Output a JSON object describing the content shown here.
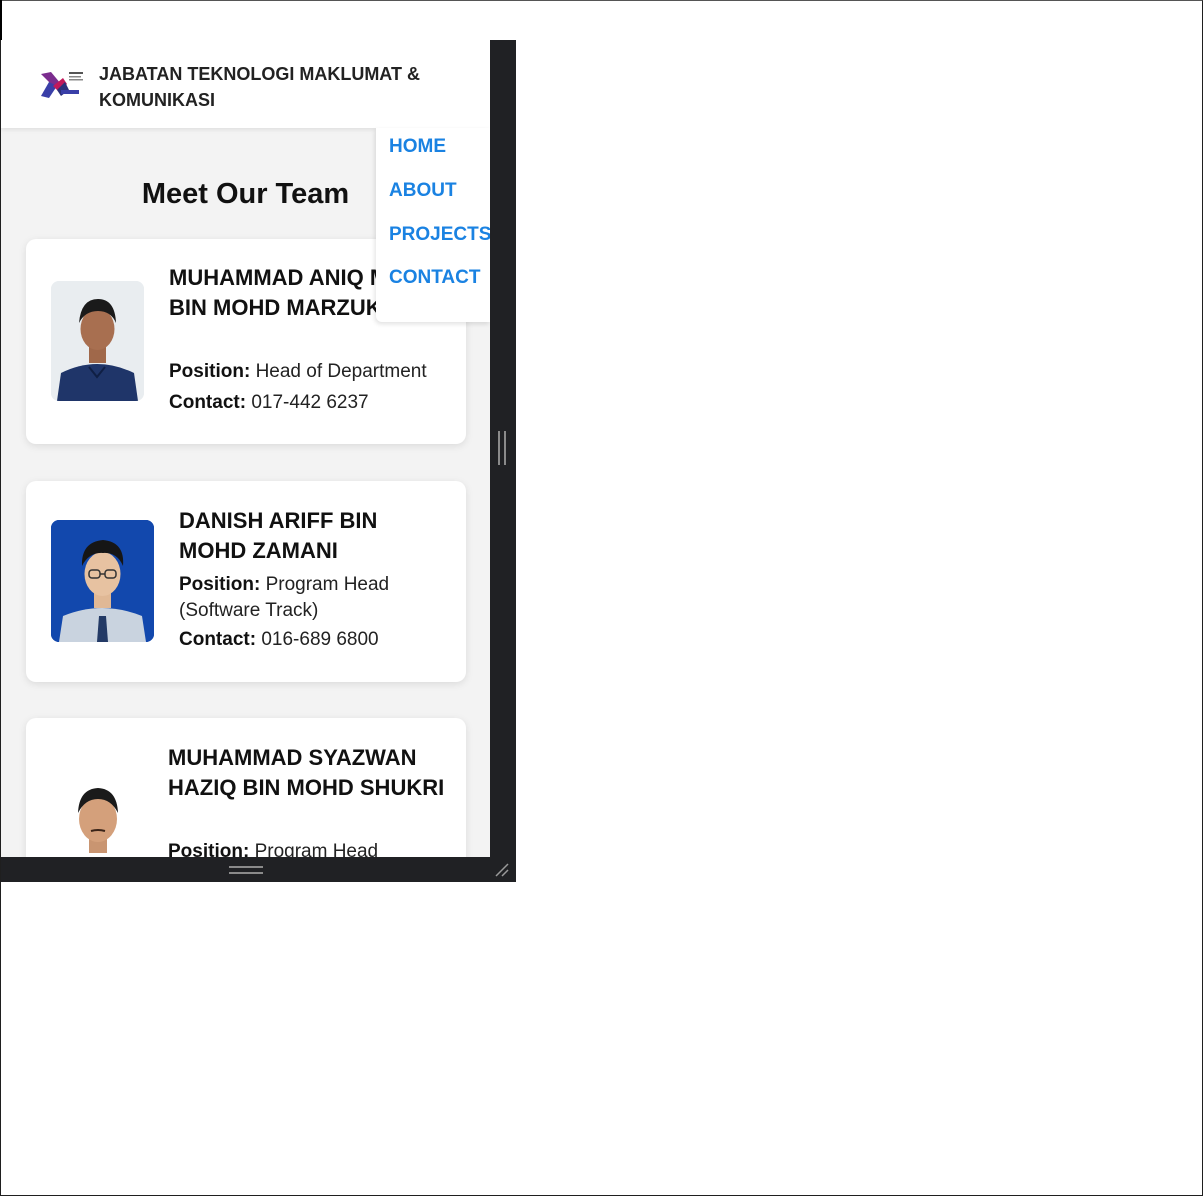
{
  "site": {
    "title": "JABATAN TEKNOLOGI MAKLUMAT & KOMUNIKASI",
    "logo_text": "JABATAN"
  },
  "nav": {
    "items": [
      {
        "label": "HOME"
      },
      {
        "label": "ABOUT"
      },
      {
        "label": "PROJECTS"
      },
      {
        "label": "CONTACT"
      }
    ]
  },
  "team": {
    "title": "Meet Our Team",
    "position_label": "Position:",
    "contact_label": "Contact:",
    "members": [
      {
        "name": "MUHAMMAD ANIQ MUQRI BIN MOHD MARZUKI",
        "position": "Head of Department",
        "contact": "017-442 6237"
      },
      {
        "name": "DANISH ARIFF BIN MOHD ZAMANI",
        "position": "Program Head (Software Track)",
        "contact": "016-689 6800"
      },
      {
        "name": "MUHAMMAD SYAZWAN HAZIQ BIN MOHD SHUKRI",
        "position": "Program Head"
      }
    ]
  },
  "colors": {
    "accent": "#1a82e2",
    "page_bg": "#f3f3f3",
    "frame_dark": "#202124"
  }
}
